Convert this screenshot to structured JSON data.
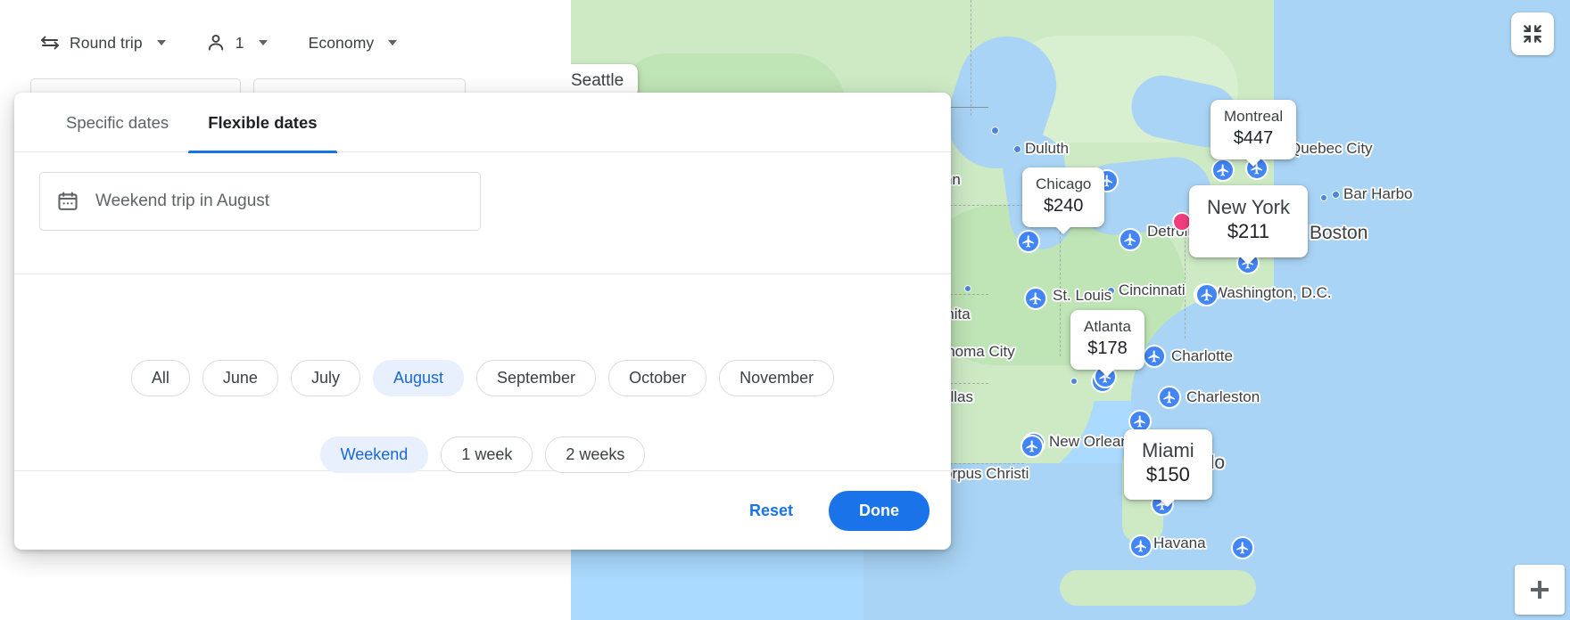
{
  "search_form": {
    "trip_type": {
      "label": "Round trip",
      "icon": "swap-horizontal-icon"
    },
    "passengers": {
      "label": "1",
      "icon": "person-icon"
    },
    "cabin_class": {
      "label": "Economy"
    }
  },
  "dialog": {
    "tabs": [
      {
        "label": "Specific dates",
        "active": false
      },
      {
        "label": "Flexible dates",
        "active": true
      }
    ],
    "search_field": {
      "icon": "calendar-icon",
      "placeholder": "Weekend trip in August",
      "value": ""
    },
    "months": [
      {
        "label": "All",
        "selected": false
      },
      {
        "label": "June",
        "selected": false
      },
      {
        "label": "July",
        "selected": false
      },
      {
        "label": "August",
        "selected": true
      },
      {
        "label": "September",
        "selected": false
      },
      {
        "label": "October",
        "selected": false
      },
      {
        "label": "November",
        "selected": false
      }
    ],
    "durations": [
      {
        "label": "Weekend",
        "selected": true
      },
      {
        "label": "1 week",
        "selected": false
      },
      {
        "label": "2 weeks",
        "selected": false
      }
    ],
    "footer": {
      "reset_label": "Reset",
      "done_label": "Done"
    }
  },
  "map": {
    "controls": {
      "collapse_label": "collapse-map-icon",
      "zoom_in_label": "+"
    },
    "price_markers": [
      {
        "city": "Montreal",
        "price": "$447"
      },
      {
        "city": "Chicago",
        "price": "$240"
      },
      {
        "city": "New York",
        "price": "$211"
      },
      {
        "city": "Atlanta",
        "price": "$178"
      },
      {
        "city": "Miami",
        "price": "$150"
      }
    ],
    "city_labels": [
      "Seattle",
      "Duluth",
      "Minn",
      "Detroit",
      "Quebec City",
      "Bar Harbo",
      "Boston",
      "Cincinnati",
      "St. Louis",
      "Washington, D.C.",
      "ichita",
      "lahoma City",
      "allas",
      "Charlotte",
      "Charleston",
      "New Orleans",
      "ndo",
      "Havana",
      "orpus Christi"
    ]
  },
  "colors": {
    "accent": "#1a73e8",
    "chip_selected_bg": "#e8f0fe",
    "chip_selected_text": "#1967d2",
    "marker_blue": "#4285f4",
    "selected_pin": "#ef3d7d",
    "map_land": "#cdeac5",
    "map_water": "#a9d4f5"
  }
}
